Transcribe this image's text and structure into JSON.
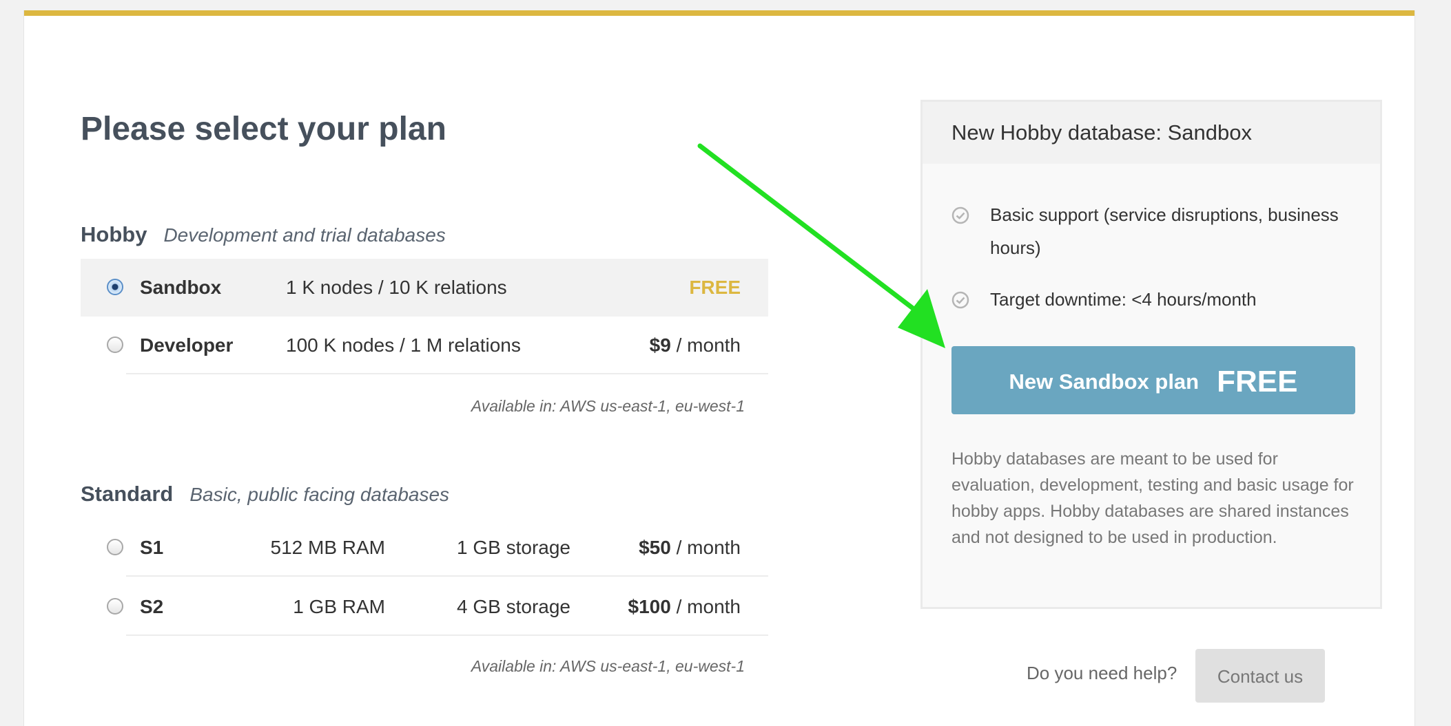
{
  "page": {
    "title": "Please select your plan"
  },
  "hobby": {
    "name": "Hobby",
    "description": "Development and trial databases",
    "plans": [
      {
        "name": "Sandbox",
        "detail": "1 K nodes / 10 K relations",
        "price": "FREE",
        "selected": true
      },
      {
        "name": "Developer",
        "detail": "100 K nodes / 1 M relations",
        "price_amount": "$9",
        "price_unit": " / month",
        "selected": false
      }
    ],
    "available": "Available in: AWS us-east-1, eu-west-1"
  },
  "standard": {
    "name": "Standard",
    "description": "Basic, public facing databases",
    "plans": [
      {
        "name": "S1",
        "ram": "512 MB RAM",
        "storage": "1 GB storage",
        "price_amount": "$50",
        "price_unit": " / month",
        "selected": false
      },
      {
        "name": "S2",
        "ram": "1 GB RAM",
        "storage": "4 GB storage",
        "price_amount": "$100",
        "price_unit": " / month",
        "selected": false
      }
    ],
    "available": "Available in: AWS us-east-1, eu-west-1"
  },
  "summary": {
    "header": "New Hobby database: Sandbox",
    "features": [
      "Basic support (service disruptions, business hours)",
      "Target downtime: <4 hours/month"
    ],
    "button_label": "New Sandbox plan",
    "button_price": "FREE",
    "note": "Hobby databases are meant to be used for evaluation, development, testing and basic usage for hobby apps. Hobby databases are shared instances and not designed to be used in production."
  },
  "help": {
    "text": "Do you need help?",
    "button": "Contact us"
  },
  "colors": {
    "accent_bar": "#dcb740",
    "free_price": "#dcb740",
    "cta_button": "#6aa6c0",
    "annotation_arrow": "#22e022"
  },
  "icons": {
    "feature_check": "check-circle-icon",
    "annotation": "green-arrow-annotation"
  }
}
